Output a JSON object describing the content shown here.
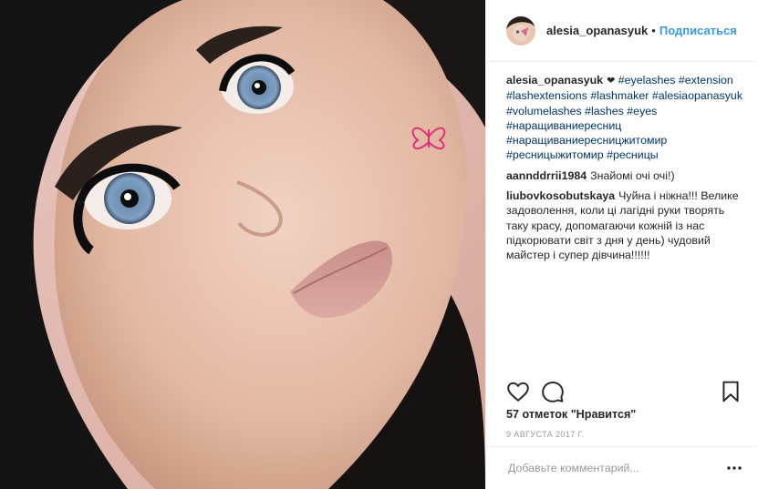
{
  "post": {
    "username": "alesia_opanasyuk",
    "separator": "•",
    "follow_label": "Подписаться",
    "avatar_icon": "profile-avatar",
    "photo_icon": "lash-portrait-photo",
    "watermark_icon": "butterfly-logo"
  },
  "caption": {
    "username": "alesia_opanasyuk",
    "emoji": "❤",
    "tags": [
      "#eyelashes",
      "#extension",
      "#lashextensions",
      "#lashmaker",
      "#alesiaopanasyuk",
      "#volumelashes",
      "#lashes",
      "#eyes",
      "#наращиваниересниц",
      "#наращиваниересницжитомир",
      "#ресницыжитомир",
      "#ресницы"
    ]
  },
  "comments": [
    {
      "username": "aannddrrii1984",
      "text": "Знайомі очі очі!)"
    },
    {
      "username": "liubovkosobutskaya",
      "text": "Чуйна і ніжна!!! Велике задоволення, коли ці лагідні руки творять таку красу, допомагаючи кожній із нас підкорювати світ з дня у день) чудовий майстер і супер дівчина!!!!!!"
    }
  ],
  "actions": {
    "like_icon": "heart-icon",
    "comment_icon": "comment-icon",
    "save_icon": "bookmark-icon"
  },
  "likes_text": "57 отметок \"Нравится\"",
  "date_text": "9 АВГУСТА 2017 Г.",
  "add_comment": {
    "placeholder": "Добавьте комментарий...",
    "more_icon": "more-dots-icon"
  },
  "colors": {
    "link": "#3897f0",
    "hashtag": "#003569",
    "text": "#262626",
    "muted": "#999999",
    "watermark": "#e0307a"
  }
}
